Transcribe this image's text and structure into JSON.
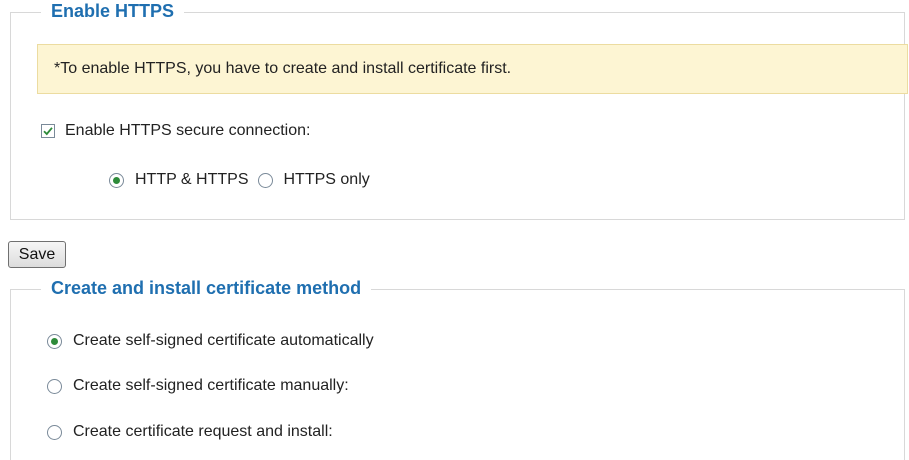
{
  "https_section": {
    "legend": "Enable HTTPS",
    "notice": "*To enable HTTPS, you have to create and install certificate first.",
    "enable_checkbox": {
      "label": "Enable HTTPS secure connection:",
      "checked": true
    },
    "modes": [
      {
        "label": "HTTP & HTTPS",
        "selected": true
      },
      {
        "label": "HTTPS only",
        "selected": false
      }
    ]
  },
  "save_label": "Save",
  "certificate_section": {
    "legend": "Create and install certificate method",
    "options": [
      {
        "label": "Create self-signed certificate automatically",
        "selected": true
      },
      {
        "label": "Create self-signed certificate manually:",
        "selected": false
      },
      {
        "label": "Create certificate request and install:",
        "selected": false
      }
    ]
  },
  "colors": {
    "legend": "#1f6fb0",
    "notice_bg": "#fdf5d3",
    "check_mark": "#2e8b3a"
  }
}
